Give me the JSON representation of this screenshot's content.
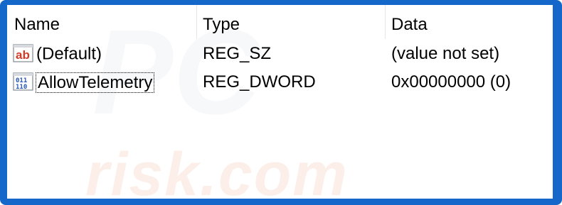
{
  "columns": {
    "name": "Name",
    "type": "Type",
    "data": "Data"
  },
  "rows": [
    {
      "icon": "string-value-icon",
      "name": "(Default)",
      "type": "REG_SZ",
      "data": "(value not set)"
    },
    {
      "icon": "binary-value-icon",
      "name": "AllowTelemetry",
      "type": "REG_DWORD",
      "data": "0x00000000 (0)"
    }
  ],
  "watermark": {
    "logo_text": "PC",
    "text": "risk.com"
  },
  "colors": {
    "frame": "#1567c9",
    "watermark": "#fcefe9"
  }
}
